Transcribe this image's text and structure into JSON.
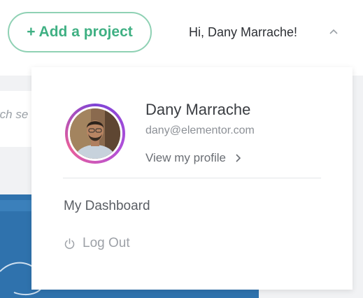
{
  "header": {
    "add_project_label": "+ Add a project",
    "greeting": "Hi, Dany Marrache!",
    "dropdown_icon": "chevron-up-icon"
  },
  "background": {
    "search_fragment": "rch se"
  },
  "user_menu": {
    "name": "Dany Marrache",
    "email": "dany@elementor.com",
    "view_profile_label": "View my profile",
    "view_profile_icon": "chevron-right-icon",
    "items": [
      {
        "label": "My Dashboard"
      },
      {
        "label": "Log Out",
        "icon": "power-icon"
      }
    ]
  },
  "colors": {
    "accent_green": "#3fb083",
    "avatar_ring": "#7e43d6"
  }
}
